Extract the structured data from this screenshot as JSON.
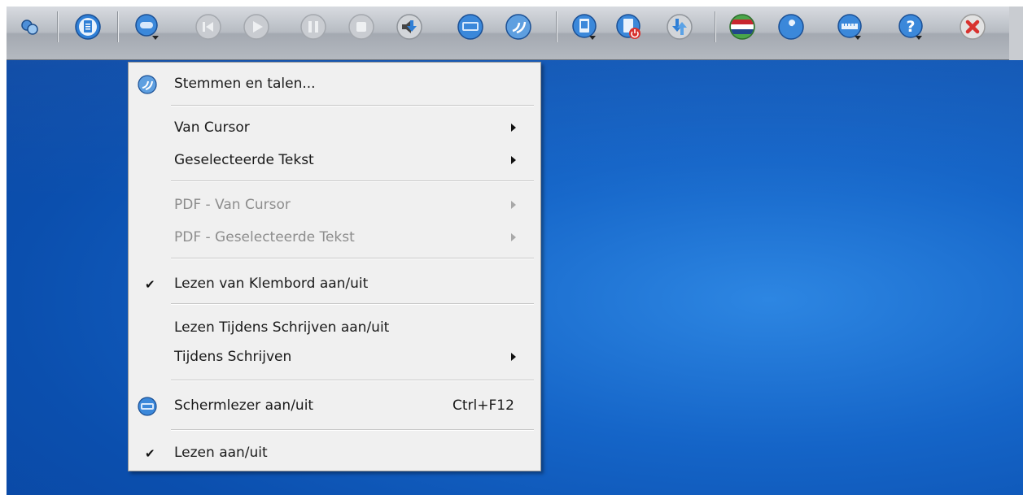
{
  "toolbar": {
    "buttons": [
      {
        "name": "link-icon"
      },
      {
        "name": "document-icon"
      },
      {
        "name": "speech-dropdown-icon"
      },
      {
        "name": "rewind-icon"
      },
      {
        "name": "play-icon"
      },
      {
        "name": "pause-icon"
      },
      {
        "name": "stop-icon"
      },
      {
        "name": "volume-icon"
      },
      {
        "name": "screen-reader-icon"
      },
      {
        "name": "voice-icon"
      },
      {
        "name": "file-save-icon"
      },
      {
        "name": "file-power-icon"
      },
      {
        "name": "convert-icon"
      },
      {
        "name": "language-flag-icon"
      },
      {
        "name": "settings-wrench-icon"
      },
      {
        "name": "ruler-icon"
      },
      {
        "name": "help-icon"
      },
      {
        "name": "close-icon"
      }
    ],
    "colors": {
      "accent": "#2f7fd6",
      "close": "#d8322e",
      "flag_red": "#c8262f",
      "flag_blue": "#21468b"
    }
  },
  "menu": {
    "voices": "Stemmen en talen...",
    "from_cursor": "Van Cursor",
    "selected_text": "Geselecteerde Tekst",
    "pdf_from_cursor": "PDF - Van Cursor",
    "pdf_selected_text": "PDF - Geselecteerde Tekst",
    "read_clipboard": "Lezen van Klembord aan/uit",
    "read_while_writing": "Lezen Tijdens Schrijven aan/uit",
    "while_writing": "Tijdens Schrijven",
    "screen_reader": "Schermlezer aan/uit",
    "screen_reader_shortcut": "Ctrl+F12",
    "read_toggle": "Lezen aan/uit",
    "checkmark": "✔"
  }
}
